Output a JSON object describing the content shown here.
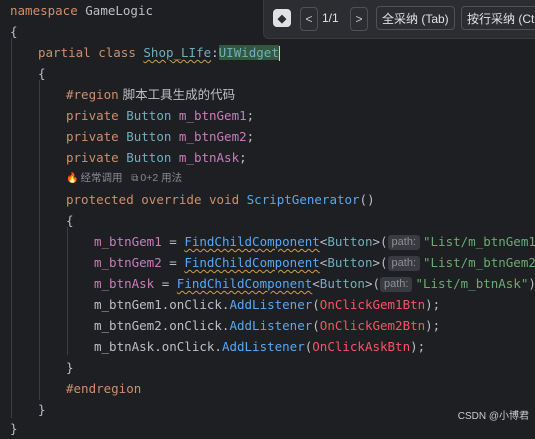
{
  "code": {
    "l1_kw": "namespace",
    "l1_name": "GameLogic",
    "l2_brace": "{",
    "l3_kw1": "partial",
    "l3_kw2": "class",
    "l3_class": "Shop_LIfe",
    "l3_colon": ":",
    "l3_base": "UIWidget",
    "l4_brace": "{",
    "l5_region_kw": "#region",
    "l5_region_text": " 脚本工具生成的代码",
    "l6_kw": "private",
    "l6_type": "Button",
    "l6_field": "m_btnGem1",
    "l7_kw": "private",
    "l7_type": "Button",
    "l7_field": "m_btnGem2",
    "l8_kw": "private",
    "l8_type": "Button",
    "l8_field": "m_btnAsk",
    "semi": ";",
    "usage_icon": "🔥",
    "usage_freq": "经常调用",
    "usage_ref_icon": "⧉",
    "usage_refs": "0+2 用法",
    "l9_kw1": "protected",
    "l9_kw2": "override",
    "l9_kw3": "void",
    "l9_method": "ScriptGenerator",
    "l9_parens": "()",
    "l10_brace": "{",
    "l11_field": "m_btnGem1",
    "l11_eq": " = ",
    "find_method": "FindChildComponent",
    "generic_open": "<",
    "generic_type": "Button",
    "generic_close": ">(",
    "hint_label": "path:",
    "l11_str": "\"List/m_btnGem1\"",
    "close_call": ");",
    "l12_field": "m_btnGem2",
    "l12_str": "\"List/m_btnGem2\"",
    "l13_field": "m_btnAsk",
    "l13_str": "\"List/m_btnAsk\"",
    "l14_obj": "m_btnGem1.onClick.",
    "l14_method": "AddListener",
    "l14_arg": "OnClickGem1Btn",
    "l15_obj": "m_btnGem2.onClick.",
    "l15_method": "AddListener",
    "l15_arg": "OnClickGem2Btn",
    "l16_obj": "m_btnAsk.onClick.",
    "l16_method": "AddListener",
    "l16_arg": "OnClickAskBtn",
    "open_paren": "(",
    "l17_brace": "}",
    "l18_endregion": "#endregion",
    "l19_brace": "}",
    "l20_brace": "}"
  },
  "toolbar": {
    "logo": "◆",
    "prev": "<",
    "next": ">",
    "count": "1/1",
    "accept_all": "全采纳 (Tab)",
    "accept_line": "按行采纳 (Ct"
  },
  "watermark": "CSDN @小博君"
}
